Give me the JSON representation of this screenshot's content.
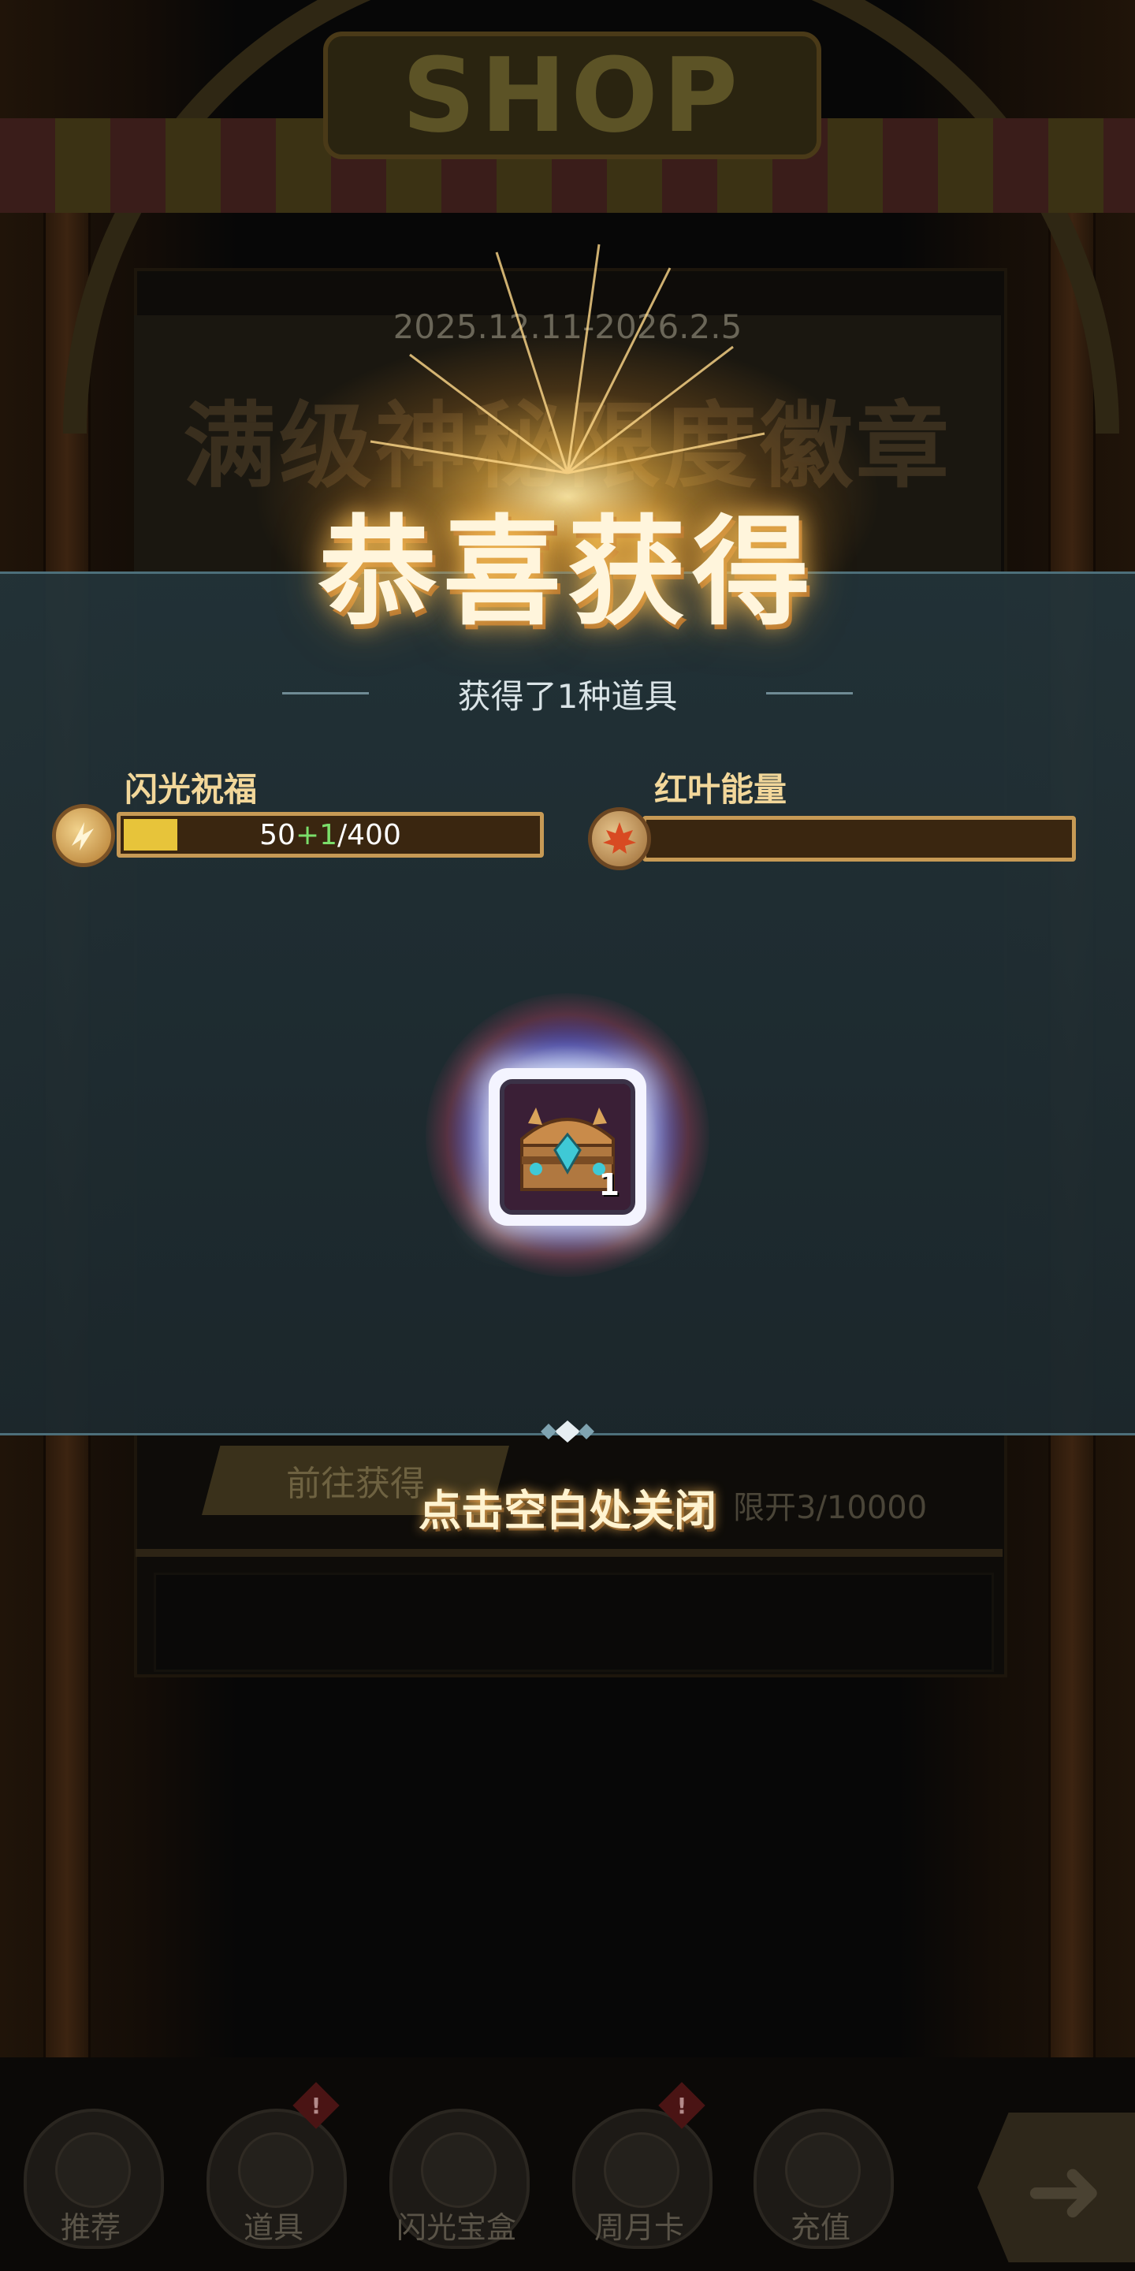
{
  "shop": {
    "sign_text": "SHOP",
    "banner_date": "2025.12.11-2026.2.5",
    "banner_title": "满级神秘限度徽章",
    "get_button_label": "前往获得",
    "limit_text": "限开3/10000"
  },
  "reward": {
    "title": "恭喜获得",
    "subtitle": "获得了1种道具",
    "flash_bar": {
      "label": "闪光祝福",
      "current": "50",
      "plus": "+1",
      "max": "/400",
      "fill_fraction": 0.13,
      "icon": "flash-blessing-icon"
    },
    "leaf_bar": {
      "label": "红叶能量",
      "fill_fraction": 0,
      "icon": "maple-leaf-icon"
    },
    "item": {
      "icon": "treasure-chest-icon",
      "count": "1"
    },
    "close_hint": "点击空白处关闭"
  },
  "nav": {
    "items": [
      {
        "label": "推荐",
        "icon": "mask-icon",
        "badge": ""
      },
      {
        "label": "道具",
        "icon": "item-bag-icon",
        "badge": "!"
      },
      {
        "label": "闪光宝盒",
        "icon": "dice-icon",
        "badge": ""
      },
      {
        "label": "周月卡",
        "icon": "arrow-up-icon",
        "badge": "!"
      },
      {
        "label": "充值",
        "icon": "gold-icon",
        "badge": ""
      }
    ],
    "next_icon": "arrow-right-icon"
  },
  "colors": {
    "overlay": "#23343a",
    "gold_text": "#f2d79a",
    "bar_fill": "#e7c43a",
    "bar_border": "#c79a55"
  }
}
